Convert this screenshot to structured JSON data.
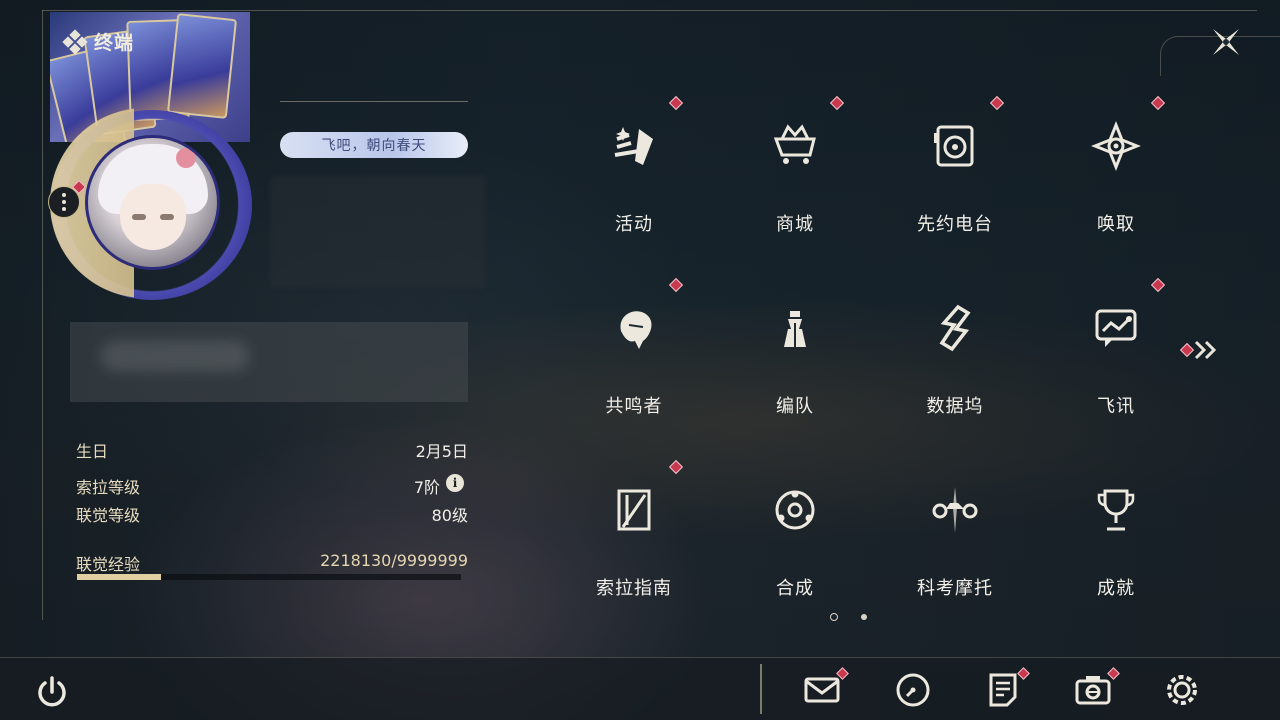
{
  "header": {
    "title": "终端"
  },
  "profile": {
    "signature": "飞吧，朝向春天",
    "stats": [
      {
        "label": "生日",
        "value": "2月5日"
      },
      {
        "label": "索拉等级",
        "value": "7阶"
      },
      {
        "label": "联觉等级",
        "value": "80级"
      }
    ],
    "exp": {
      "label": "联觉经验",
      "value": "2218130/9999999",
      "fraction": 0.22
    }
  },
  "menu": {
    "items": [
      {
        "label": "活动",
        "icon": "event-icon",
        "badge": true
      },
      {
        "label": "商城",
        "icon": "shop-icon",
        "badge": true
      },
      {
        "label": "先约电台",
        "icon": "radio-icon",
        "badge": true
      },
      {
        "label": "唤取",
        "icon": "convene-icon",
        "badge": true
      },
      {
        "label": "共鸣者",
        "icon": "resonator-icon",
        "badge": true
      },
      {
        "label": "编队",
        "icon": "team-icon",
        "badge": false
      },
      {
        "label": "数据坞",
        "icon": "databank-icon",
        "badge": false
      },
      {
        "label": "飞讯",
        "icon": "message-icon",
        "badge": true
      },
      {
        "label": "索拉指南",
        "icon": "guidebook-icon",
        "badge": true
      },
      {
        "label": "合成",
        "icon": "synthesis-icon",
        "badge": false
      },
      {
        "label": "科考摩托",
        "icon": "motorbike-icon",
        "badge": false
      },
      {
        "label": "成就",
        "icon": "achievement-icon",
        "badge": false
      }
    ],
    "page_count": 2,
    "current_page": 1
  },
  "bottom": {
    "icons": [
      "mail-icon",
      "clock-icon",
      "notice-icon",
      "camera-icon",
      "settings-icon"
    ],
    "badges": [
      true,
      false,
      true,
      true,
      false
    ]
  },
  "colors": {
    "accent_gold": "#e0cfa3",
    "badge_red": "#c8394f",
    "text": "#f2efe8"
  }
}
